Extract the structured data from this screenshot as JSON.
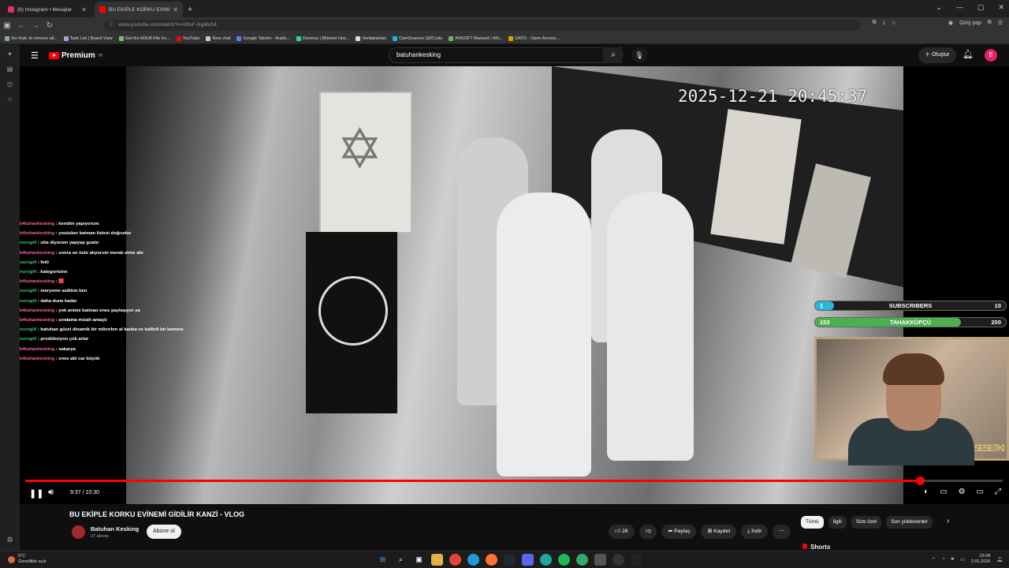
{
  "browser": {
    "tabs": [
      {
        "label": "(6) Instagram • Mesajlar",
        "active": false,
        "color": "#e1306c"
      },
      {
        "label": "BU EKİPLE KORKU EVİNEMİ",
        "active": true,
        "color": "#ff0000"
      }
    ],
    "new_tab": "+",
    "url": "www.youtube.com/watch?v=D9sF-NgMxS4",
    "profile_label": "Giriş yap",
    "bookmarks": [
      {
        "label": "Sci-Hub: to remove all...",
        "color": "#8aa"
      },
      {
        "label": "Task List | Board View",
        "color": "#9ad"
      },
      {
        "label": "Get the M3U8 File fro...",
        "color": "#6c6"
      },
      {
        "label": "YouTube",
        "color": "#f00"
      },
      {
        "label": "New chat",
        "color": "#ccc"
      },
      {
        "label": "Google Takvim - Aralık...",
        "color": "#4a8af4"
      },
      {
        "label": "Desmos | Bilimsel Hes...",
        "color": "#2d8"
      },
      {
        "label": "Veritabanları",
        "color": "#ddd"
      },
      {
        "label": "CamScanner QRCode",
        "color": "#1cb0f6"
      },
      {
        "label": "ANSOFT Maxwell / AN...",
        "color": "#6b6"
      },
      {
        "label": "OATD - Open Access ...",
        "color": "#e90"
      }
    ]
  },
  "youtube": {
    "logo": "Premium",
    "logo_sup": "TR",
    "search_value": "batuhankesking",
    "create_label": "Oluştur",
    "avatar_letter": "B"
  },
  "video": {
    "timestamp": "2025-12-21  20:45:37",
    "time": "9:37 / 10:30",
    "progress": 0.915,
    "chat": [
      {
        "user": "b4tuhankesking",
        "msg": "kendim yapıyorum",
        "color": "#ff5fa8"
      },
      {
        "user": "b4tuhankesking",
        "msg": "youtuber katman listesi doğrudur",
        "color": "#ff5fa8"
      },
      {
        "user": "nurogl4",
        "msg": "oha diyorum yapyap goatır",
        "color": "#2ecc71"
      },
      {
        "user": "b4tuhankesking",
        "msg": "sonra en üste alıyorum merak etme abi",
        "color": "#ff5fa8"
      },
      {
        "user": "nurogl4",
        "msg": "fetö",
        "color": "#2ecc71"
      },
      {
        "user": "nurogl4",
        "msg": "kategorisine",
        "color": "#2ecc71"
      },
      {
        "user": "b4tuhankesking",
        "msg": "🟥",
        "color": "#ff5fa8"
      },
      {
        "user": "nurogl4",
        "msg": "meryeme asiktım ben",
        "color": "#2ecc71"
      },
      {
        "user": "nurogl4",
        "msg": "daha dune kadar",
        "color": "#2ecc71"
      },
      {
        "user": "b4tuhankesking",
        "msg": "yok anime katman enes paylaşıyor ya",
        "color": "#ff5fa8"
      },
      {
        "user": "b4tuhankesking",
        "msg": "sıralama mizah amaçlı",
        "color": "#ff5fa8"
      },
      {
        "user": "nurogl4",
        "msg": "batuhan güzel dinamik bir mikrofon al kanka ve kaliteli bir kamera",
        "color": "#2ecc71"
      },
      {
        "user": "nurogl4",
        "msg": "prodüksiyon çok artar",
        "color": "#2ecc71"
      },
      {
        "user": "b4tuhankesking",
        "msg": "sakarya",
        "color": "#ff5fa8"
      },
      {
        "user": "b4tuhankesking",
        "msg": "enes abi car büyük",
        "color": "#ff5fa8"
      }
    ],
    "goals": [
      {
        "left": "1",
        "label": "SUBSCRIBERS",
        "right": "10",
        "fill": 0.1,
        "color": "#29b6d8"
      },
      {
        "left": "153",
        "label": "TAHAKKÜPÇÜ",
        "right": "200",
        "fill": 0.765,
        "color": "#4caf50"
      }
    ],
    "cam_ornament": "SESETKI"
  },
  "meta": {
    "title": "BU EKİPLE KORKU EVİNEMİ GİDİLİR KANZİ - VLOG",
    "channel": "Batuhan Kesking",
    "subs": "27 abone",
    "subscribe": "Abone ol",
    "likes": "28",
    "share": "Paylaş",
    "save": "Kaydet",
    "download": "İndir",
    "chips": [
      "Tümü",
      "İlgili",
      "Size özel",
      "Son yüklenenler"
    ],
    "shorts": "Shorts"
  },
  "taskbar": {
    "temp": "5°C",
    "weather": "Genellikle açık",
    "time": "23:08",
    "date": "2.01.2026"
  }
}
